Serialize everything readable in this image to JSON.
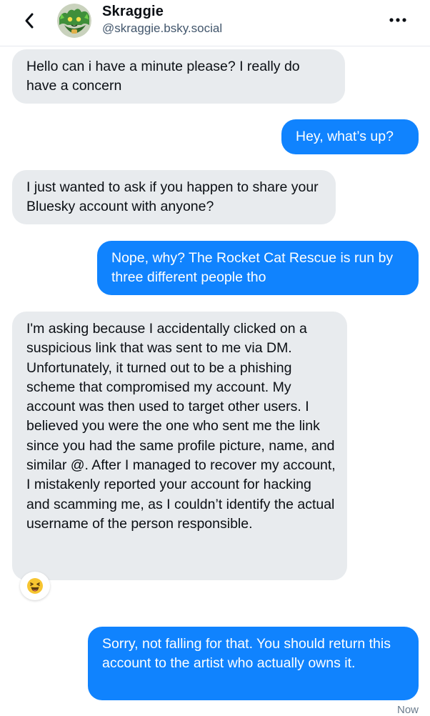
{
  "header": {
    "name": "Skraggie",
    "handle": "@skraggie.bsky.social"
  },
  "messages": [
    {
      "direction": "in",
      "text": "Hello can i have a minute please? I really do have a concern"
    },
    {
      "direction": "out",
      "text": "Hey, what’s up?"
    },
    {
      "direction": "in",
      "text": "I just wanted to ask if you happen to share your Bluesky account with anyone?"
    },
    {
      "direction": "out",
      "text": "Nope, why? The Rocket Cat Rescue is run by three different people tho"
    },
    {
      "direction": "in",
      "text": "I'm asking because I accidentally clicked on a suspicious link that was sent to me via DM. Unfortunately, it turned out to be a phishing scheme that compromised my account. My account was then used to target other users. I believed you were the one who sent me the link since you had the same profile picture, name, and similar @. After I managed to recover my account, I mistakenly reported your account for hacking and scamming me, as I couldn’t identify the actual username of the person responsible."
    },
    {
      "direction": "out",
      "text": "Sorry, not falling for that. You should return this account to the artist who actually owns it."
    }
  ],
  "reaction": "laughing-emoji",
  "timestamp": "Now",
  "colors": {
    "outgoing_bubble": "#1083fe",
    "incoming_bubble": "#e8ebee"
  }
}
